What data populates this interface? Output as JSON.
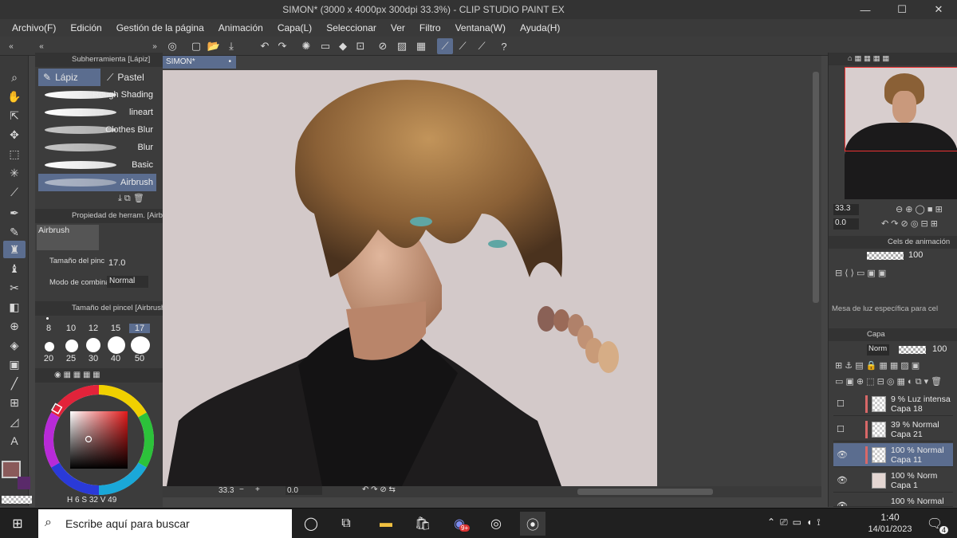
{
  "window": {
    "title": "SIMON* (3000 x 4000px 300dpi 33.3%)  - CLIP STUDIO PAINT EX",
    "minimize": "—",
    "maximize": "☐",
    "close": "✕"
  },
  "menu": [
    "Archivo(F)",
    "Edición",
    "Gestión de la página",
    "Animación",
    "Capa(L)",
    "Seleccionar",
    "Ver",
    "Filtro",
    "Ventana(W)",
    "Ayuda(H)"
  ],
  "document": {
    "tab": "SIMON*"
  },
  "subtool": {
    "header": "Subherramienta [Lápiz]",
    "tabs": [
      "Lápiz",
      "Pastel"
    ],
    "brushes": [
      "Rough Shading",
      "lineart",
      "Clothes Blur",
      "Blur",
      "Basic",
      "Airbrush"
    ]
  },
  "tool_property": {
    "header": "Propiedad de herram. [Airbr",
    "tool_name": "Airbrush",
    "brush_size_label": "Tamaño del pinc",
    "brush_size_value": "17.0",
    "blend_label": "Modo de combina",
    "blend_value": "Normal"
  },
  "brush_size_panel": {
    "header": "Tamaño del pincel [Airbrush",
    "sizes_row1": [
      "8",
      "10",
      "12",
      "15",
      "17"
    ],
    "sizes_row2": [
      "20",
      "25",
      "30",
      "40",
      "50"
    ]
  },
  "color": {
    "main": "#8a5a5a",
    "sub": "#5a2a6a",
    "readout": [
      "H",
      "6",
      "S",
      "32",
      "V",
      "49"
    ]
  },
  "navigator": {
    "zoom": "33.3",
    "rotation": "0.0"
  },
  "animation": {
    "header": "Cels de animación",
    "opacity": "100",
    "lightbox_note": "Mesa de luz específica para cel"
  },
  "layers": {
    "header": "Capa",
    "blend": "Norm",
    "opacity": "100",
    "items": [
      {
        "line1": "9 % Luz intensa",
        "line2": "Capa 18"
      },
      {
        "line1": "39 % Normal",
        "line2": "Capa 21"
      },
      {
        "line1": "100 % Normal",
        "line2": "Capa 11"
      },
      {
        "line1": "100 % Norm",
        "line2": "Capa 1"
      },
      {
        "line1": "100 % Normal",
        "line2": ""
      }
    ]
  },
  "status": {
    "zoom": "33.3",
    "angle": "0.0"
  },
  "taskbar": {
    "search_placeholder": "Escribe aquí para buscar",
    "badge": "9+",
    "time": "1:40",
    "date": "14/01/2023",
    "notifications": "4"
  },
  "palette": {
    "swatches": [
      "#8a6156",
      "#9a6a58",
      "#b0816a",
      "#c19275",
      "#c99b78",
      "#d6ad86"
    ]
  }
}
